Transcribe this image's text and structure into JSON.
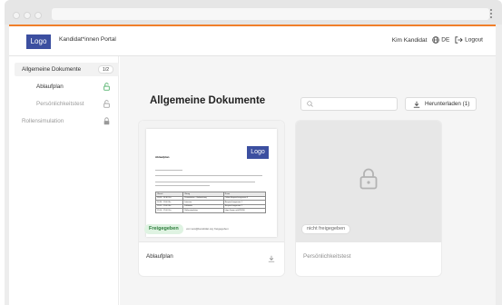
{
  "header": {
    "logo": "Logo",
    "portal_name": "Kandidat*innen Portal",
    "user_name": "Kim Kandidat",
    "language": "DE",
    "logout": "Logout"
  },
  "sidebar": {
    "items": [
      {
        "label": "Allgemeine Dokumente",
        "count": "1/2"
      },
      {
        "label": "Ablaufplan",
        "icon": "unlock-icon",
        "status_color": "#3fa95a"
      },
      {
        "label": "Persönlichkeitstest",
        "icon": "unlock-icon"
      },
      {
        "label": "Rollensimulation",
        "icon": "lock-icon"
      }
    ]
  },
  "main": {
    "title": "Allgemeine Dokumente",
    "search": {
      "placeholder": ""
    },
    "download_button": "Herunterladen (1)"
  },
  "cards": [
    {
      "title": "Ablaufplan",
      "status": "Freigegeben",
      "status_note": "von test@kandidat.org freigegeben",
      "preview": {
        "logo": "Logo",
        "heading": "Ablaufplan",
        "table": [
          [
            "Uhrzeit",
            "Übung",
            "Raum"
          ],
          [
            "10:00 - 10:30 Uhr",
            "Präsentation - Vorbereitung",
            "Online Besprechungsraum 3"
          ],
          [
            "10:30 - 11:00 Uhr",
            "Interview",
            "Besprechungsraum 1"
          ],
          [
            "11:00 - 12:00 Uhr",
            "Fallstudie",
            "Besprechungsraum 1"
          ],
          [
            "12:00 - 17:00 Uhr",
            "Rollensimulation",
            "https://zoom.us/j/123456"
          ]
        ]
      }
    },
    {
      "title": "Persönlichkeitstest",
      "status": "nicht freigegeben"
    }
  ],
  "colors": {
    "accent": "#f07f2a",
    "brand": "#3c4fa0",
    "released": "#3fa95a"
  }
}
